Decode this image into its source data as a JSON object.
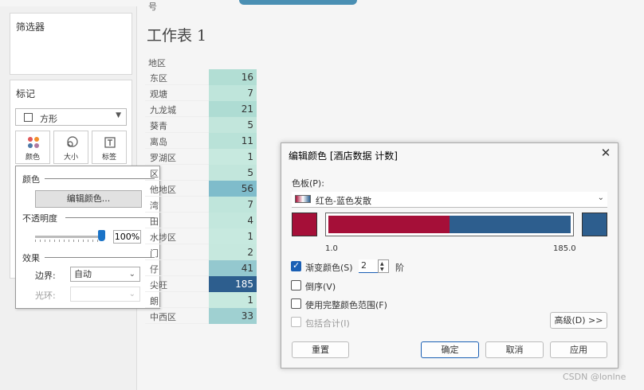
{
  "top": {
    "tab_left": "号"
  },
  "filters": {
    "title": "筛选器"
  },
  "marks": {
    "title": "标记",
    "mark_type": "方形",
    "buttons": {
      "color": "颜色",
      "size": "大小",
      "label": "标签"
    }
  },
  "color_popup": {
    "color_section": "颜色",
    "edit_colors_button": "编辑颜色...",
    "opacity_section": "不透明度",
    "opacity_value": "100%",
    "opacity_fraction": 1.0,
    "effects_section": "效果",
    "border_label": "边界:",
    "border_value": "自动",
    "halo_label": "光环:",
    "halo_value": ""
  },
  "sheet": {
    "title": "工作表 1",
    "column_header": "地区",
    "rows": [
      {
        "label": "东区",
        "value": "16",
        "color": "#b2ded4"
      },
      {
        "label": "观塘",
        "value": "7",
        "color": "#bfe5db"
      },
      {
        "label": "九龙城",
        "value": "21",
        "color": "#aedcd3"
      },
      {
        "label": "葵青",
        "value": "5",
        "color": "#c2e6dc"
      },
      {
        "label": "离岛",
        "value": "11",
        "color": "#b9e2d8"
      },
      {
        "label": "罗湖区",
        "value": "1",
        "color": "#c7e9df"
      },
      {
        "label": "区",
        "value": "5",
        "color": "#c2e6dc"
      },
      {
        "label": "他地区",
        "value": "56",
        "color": "#7fbccb"
      },
      {
        "label": "湾",
        "value": "7",
        "color": "#bfe5db"
      },
      {
        "label": "田",
        "value": "4",
        "color": "#c3e7dd"
      },
      {
        "label": "水埗区",
        "value": "1",
        "color": "#c7e9df"
      },
      {
        "label": "门",
        "value": "2",
        "color": "#c6e8de"
      },
      {
        "label": "仔",
        "value": "41",
        "color": "#94c8cf"
      },
      {
        "label": "尖旺",
        "value": "185",
        "color": "#2d5e8e"
      },
      {
        "label": "朗",
        "value": "1",
        "color": "#c7e9df"
      },
      {
        "label": "中西区",
        "value": "33",
        "color": "#9fd0d1"
      }
    ]
  },
  "dialog": {
    "title": "编辑颜色 [酒店数据 计数]",
    "close": "✕",
    "palette_label": "色板(P):",
    "palette_value": "红色-蓝色发散",
    "range_min": "1.0",
    "range_max": "185.0",
    "midpoint_fraction": 0.5,
    "colors": {
      "low": "#a50f38",
      "high": "#2d5e8e"
    },
    "stepped_label": "渐变颜色(S)",
    "stepped_checked": true,
    "steps_value": "2",
    "steps_suffix": "阶",
    "reversed_label": "倒序(V)",
    "full_range_label": "使用完整颜色范围(F)",
    "include_totals_label": "包括合计(I)",
    "advanced_button": "高级(D) >>",
    "reset_button": "重置",
    "ok_button": "确定",
    "cancel_button": "取消",
    "apply_button": "应用"
  },
  "watermark": "CSDN @lonlne"
}
